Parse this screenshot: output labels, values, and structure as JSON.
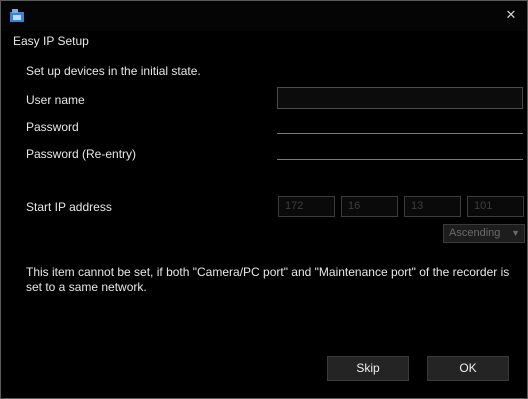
{
  "window": {
    "dialog_title": "Easy IP Setup",
    "close_glyph": "✕"
  },
  "form": {
    "intro": "Set up devices in the initial state.",
    "user_name_label": "User name",
    "password_label": "Password",
    "password_reentry_label": "Password (Re-entry)",
    "start_ip_label": "Start IP address",
    "ip_octets": [
      "172",
      "16",
      "13",
      "101"
    ],
    "order_selected": "Ascending"
  },
  "note": "This item cannot be set, if both \"Camera/PC port\" and \"Maintenance port\" of the recorder is set to a same network.",
  "buttons": {
    "skip": "Skip",
    "ok": "OK"
  },
  "colors": {
    "background": "#000000",
    "text": "#e8e8e8",
    "disabled_text": "#3e3e3e",
    "button_bg": "#242424",
    "app_icon": "#4a90d9"
  },
  "icons": {
    "app": "app-icon",
    "close": "close-icon",
    "select": "chevron-down-icon"
  }
}
